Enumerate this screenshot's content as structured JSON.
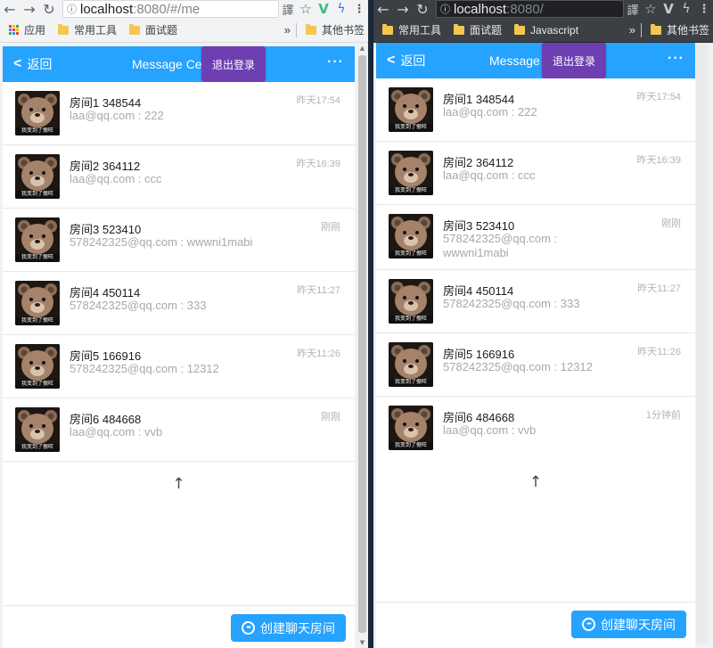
{
  "browser": {
    "url_host": "localhost",
    "url_left_rest": ":8080/#/me",
    "url_right_rest": ":8080/",
    "bookmarks": {
      "apps": "应用",
      "folder1": "常用工具",
      "folder2": "面试题",
      "folder3": "Javascript",
      "more": "»",
      "other": "其他书签"
    }
  },
  "app": {
    "back_label": "返回",
    "title": "Message Center",
    "more_label": "···",
    "logout_label": "退出登录",
    "create_room_label": "创建聊天房间",
    "load_more_symbol": "↑",
    "colors": {
      "header": "#26a2ff",
      "logout": "#6d3fb0",
      "time": "#b4b4b4"
    }
  },
  "rooms_left": [
    {
      "name": "房间1 348544",
      "last": "laa@qq.com : 222",
      "time": "昨天17:54"
    },
    {
      "name": "房间2 364112",
      "last": "laa@qq.com : ccc",
      "time": "昨天16:39"
    },
    {
      "name": "房间3 523410",
      "last": "578242325@qq.com : wwwni1mabi",
      "time": "刚刚"
    },
    {
      "name": "房间4 450114",
      "last": "578242325@qq.com : 333",
      "time": "昨天11:27"
    },
    {
      "name": "房间5 166916",
      "last": "578242325@qq.com : 12312",
      "time": "昨天11:26"
    },
    {
      "name": "房间6 484668",
      "last": "laa@qq.com : vvb",
      "time": "刚刚"
    }
  ],
  "rooms_right": [
    {
      "name": "房间1 348544",
      "last": "laa@qq.com : 222",
      "time": "昨天17:54"
    },
    {
      "name": "房间2 364112",
      "last": "laa@qq.com : ccc",
      "time": "昨天16:39"
    },
    {
      "name": "房间3 523410",
      "last": "578242325@qq.com :",
      "last2": "wwwni1mabi",
      "time": "刚刚"
    },
    {
      "name": "房间4 450114",
      "last": "578242325@qq.com : 333",
      "time": "昨天11:27"
    },
    {
      "name": "房间5 166916",
      "last": "578242325@qq.com : 12312",
      "time": "昨天11:26"
    },
    {
      "name": "房间6 484668",
      "last": "laa@qq.com : vvb",
      "time": "1分钟前"
    }
  ],
  "avatar_caption": "我变到了傲旺",
  "icons": [
    "back-arrow-icon",
    "forward-arrow-icon",
    "reload-icon",
    "translate-icon",
    "star-icon",
    "vue-devtools-icon",
    "bolt-icon",
    "menu-dots-icon",
    "folder-icon",
    "apps-icon",
    "chevron-left-icon",
    "chat-bubble-icon",
    "bear-avatar-icon"
  ]
}
